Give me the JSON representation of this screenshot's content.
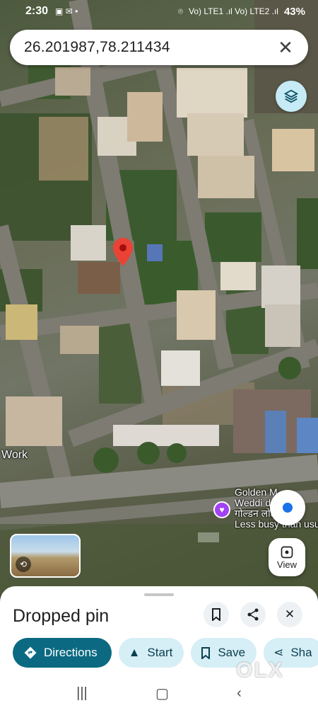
{
  "status_bar": {
    "time": "2:30",
    "network": "Vo) LTE1 .ıl Vo) LTE2 .ıl",
    "battery": "43%"
  },
  "search": {
    "query": "26.201987,78.211434",
    "clear_icon": "close-icon"
  },
  "map": {
    "labels": {
      "work": "Work",
      "poi_line1": "Golden  M",
      "poi_line2": "Weddi  der",
      "poi_line3": "गोल्डन लोट",
      "poi_busy": "Less busy than usua"
    },
    "view_label": "View"
  },
  "place": {
    "title": "Dropped pin"
  },
  "actions": [
    {
      "label": "Directions",
      "icon": "directions-icon"
    },
    {
      "label": "Start",
      "icon": "navigation-icon"
    },
    {
      "label": "Save",
      "icon": "bookmark-icon"
    },
    {
      "label": "Sha",
      "icon": "share-icon"
    }
  ],
  "watermark": "OLX",
  "colors": {
    "primary": "#0b6a82",
    "chip_bg": "#d6eef6",
    "pin": "#ea4335",
    "poi": "#a142f4"
  }
}
